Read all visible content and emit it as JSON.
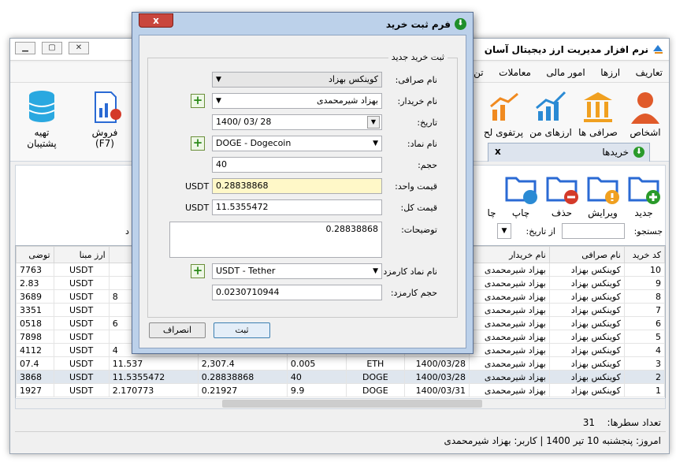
{
  "app": {
    "title": "نرم افزار مدیریت ارز دیجیتال آسان",
    "menu": [
      "تعاریف",
      "ارزها",
      "امور مالی",
      "معاملات",
      "تن"
    ],
    "ribbon": [
      "اشخاص",
      "صرافی ها",
      "ارزهای من",
      "پرتفوی لح",
      "فروش (F7)",
      "تهیه پشتیبان"
    ],
    "tab": "خریدها",
    "toolbar": [
      "جدید",
      "ویرایش",
      "حذف",
      "چاپ",
      "چا"
    ],
    "search_label": "جستجو:",
    "date_filter_label": "از تاریخ:",
    "grid": {
      "columns_right": [
        "کد خرید",
        "نام صرافی",
        "نام خریدار"
      ],
      "columns_left": [
        "ارز مبنا",
        "توضی"
      ],
      "rows": [
        {
          "id": "10",
          "exchange": "کوینکس بهزاد",
          "buyer": "بهزاد شیرمحمدی",
          "date": "",
          "coin": "",
          "vol": "",
          "unit": "",
          "total": "",
          "base": "USDT",
          "desc": "7763"
        },
        {
          "id": "9",
          "exchange": "کوینکس بهزاد",
          "buyer": "بهزاد شیرمحمدی",
          "date": "",
          "coin": "",
          "vol": "",
          "unit": "",
          "total": "",
          "base": "USDT",
          "desc": "2.83"
        },
        {
          "id": "8",
          "exchange": "کوینکس بهزاد",
          "buyer": "بهزاد شیرمحمدی",
          "date": "",
          "coin": "",
          "vol": "",
          "unit": "",
          "total": "8",
          "base": "USDT",
          "desc": "3689"
        },
        {
          "id": "7",
          "exchange": "کوینکس بهزاد",
          "buyer": "بهزاد شیرمحمدی",
          "date": "",
          "coin": "",
          "vol": "",
          "unit": "",
          "total": "",
          "base": "USDT",
          "desc": "3351"
        },
        {
          "id": "6",
          "exchange": "کوینکس بهزاد",
          "buyer": "بهزاد شیرمحمدی",
          "date": "",
          "coin": "",
          "vol": "",
          "unit": "",
          "total": "6",
          "base": "USDT",
          "desc": "0518"
        },
        {
          "id": "5",
          "exchange": "کوینکس بهزاد",
          "buyer": "بهزاد شیرمحمدی",
          "date": "",
          "coin": "",
          "vol": "",
          "unit": "",
          "total": "",
          "base": "USDT",
          "desc": "7898"
        },
        {
          "id": "4",
          "exchange": "کوینکس بهزاد",
          "buyer": "بهزاد شیرمحمدی",
          "date": "",
          "coin": "",
          "vol": "",
          "unit": "",
          "total": "4",
          "base": "USDT",
          "desc": "4112"
        },
        {
          "id": "3",
          "exchange": "کوینکس بهزاد",
          "buyer": "بهزاد شیرمحمدی",
          "date": "1400/03/28",
          "coin": "ETH",
          "vol": "0.005",
          "unit": "2,307.4",
          "total": "11.537",
          "base": "USDT",
          "desc": "07.4"
        },
        {
          "id": "2",
          "exchange": "کوینکس بهزاد",
          "buyer": "بهزاد شیرمحمدی",
          "date": "1400/03/28",
          "coin": "DOGE",
          "vol": "40",
          "unit": "0.28838868",
          "total": "11.5355472",
          "base": "USDT",
          "desc": "3868"
        },
        {
          "id": "1",
          "exchange": "کوینکس بهزاد",
          "buyer": "بهزاد شیرمحمدی",
          "date": "1400/03/31",
          "coin": "DOGE",
          "vol": "9.9",
          "unit": "0.21927",
          "total": "2.170773",
          "base": "USDT",
          "desc": "1927"
        }
      ]
    },
    "row_count_label": "تعداد سطرها:",
    "row_count": "31",
    "status": "امروز: پنجشنبه 10 تیر 1400 | کاربر: بهزاد شیرمحمدی"
  },
  "dialog": {
    "title": "فرم ثبت خرید",
    "close": "x",
    "group": "ثبت خرید جدید",
    "fields": {
      "exchange": {
        "label": "نام صرافی:",
        "value": "کوینکس بهزاد"
      },
      "buyer": {
        "label": "نام خریدار:",
        "value": "بهزاد شیرمحمدی"
      },
      "date": {
        "label": "تاریخ:",
        "value": "1400/ 03/ 28"
      },
      "coin": {
        "label": "نام نماد:",
        "value": "DOGE - Dogecoin"
      },
      "volume": {
        "label": "حجم:",
        "value": "40"
      },
      "unit_price": {
        "label": "قیمت واحد:",
        "value": "0.28838868",
        "unit": "USDT"
      },
      "total_price": {
        "label": "قیمت کل:",
        "value": "11.5355472",
        "unit": "USDT"
      },
      "description": {
        "label": "توضیحات:",
        "value": "0.28838868"
      },
      "fee_coin": {
        "label": "نام نماد کارمزد:",
        "value": "USDT - Tether"
      },
      "fee_volume": {
        "label": "حجم کارمزد:",
        "value": "0.0230710944"
      }
    },
    "submit": "ثبت",
    "cancel": "انصراف"
  }
}
